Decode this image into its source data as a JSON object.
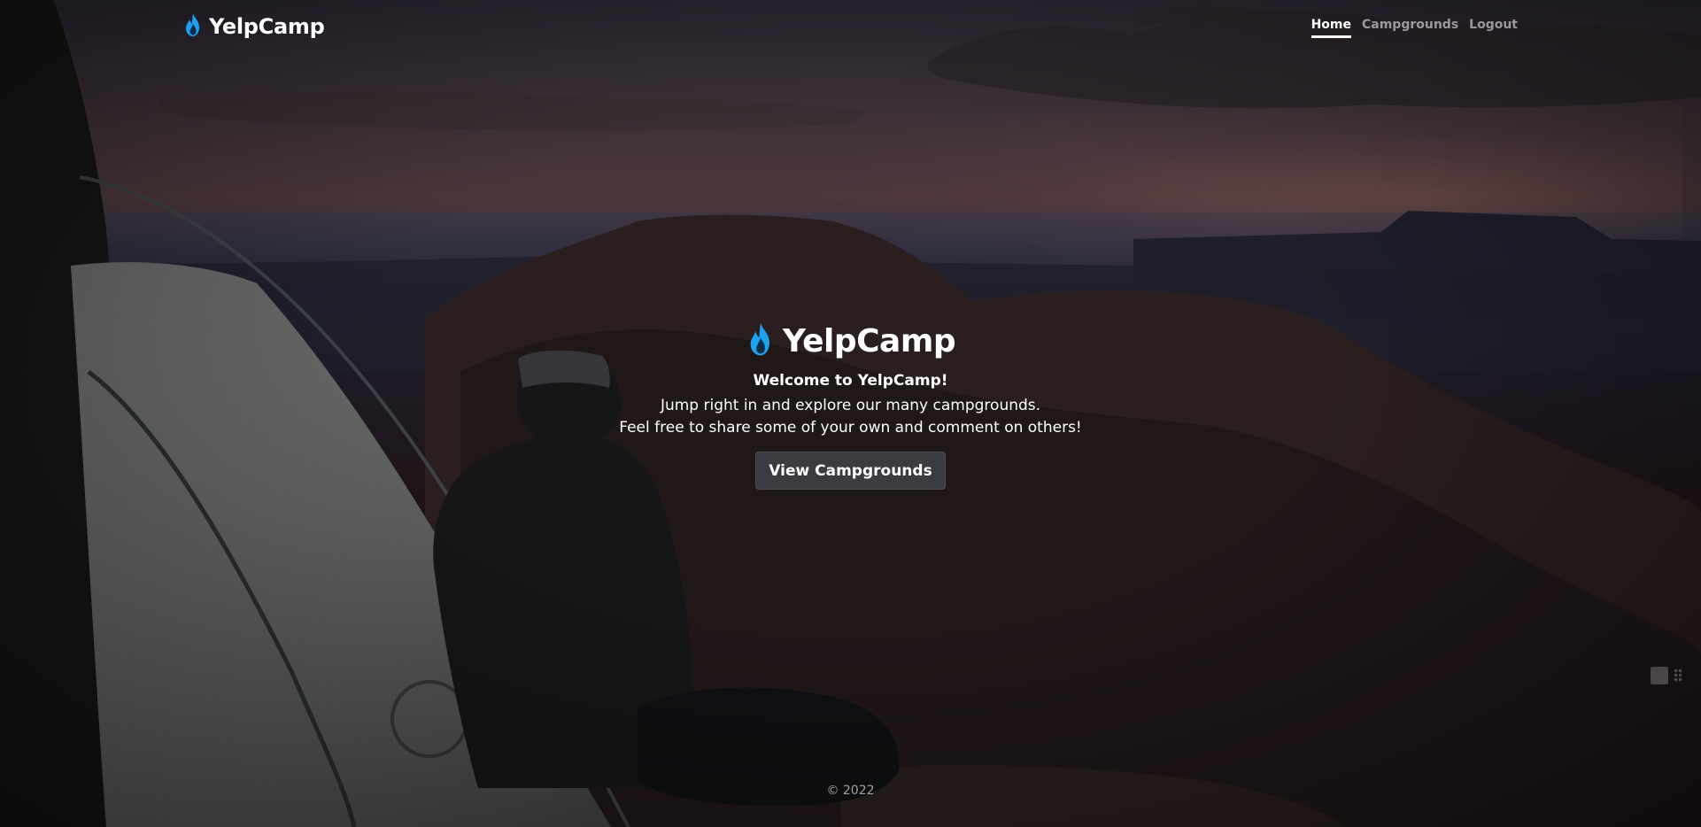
{
  "header": {
    "brand": {
      "name": "YelpCamp",
      "icon": "flame-icon"
    },
    "nav": [
      {
        "label": "Home",
        "active": true
      },
      {
        "label": "Campgrounds",
        "active": false
      },
      {
        "label": "Logout",
        "active": false
      }
    ]
  },
  "hero": {
    "icon": "flame-icon",
    "title": "YelpCamp",
    "welcome": "Welcome to YelpCamp!",
    "line1": "Jump right in and explore our many campgrounds.",
    "line2": "Feel free to share some of your own and comment on others!",
    "cta_label": "View Campgrounds"
  },
  "footer": {
    "copyright": "© 2022"
  },
  "colors": {
    "accent_icon": "#1da1f2",
    "button_bg": "#3a3c42",
    "nav_inactive": "rgba(255,255,255,0.55)"
  }
}
